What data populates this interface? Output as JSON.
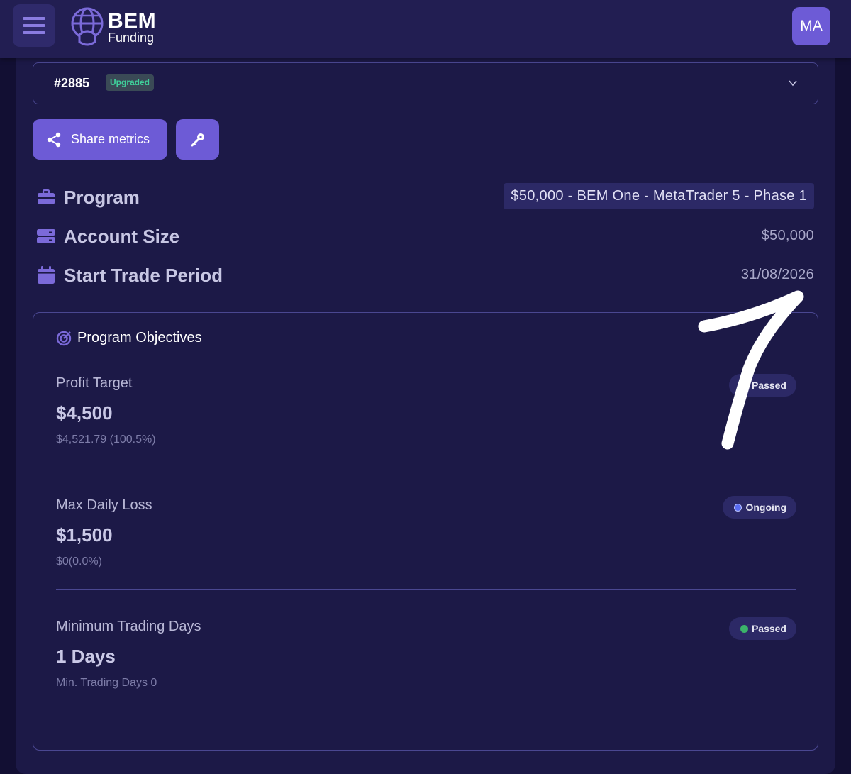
{
  "header": {
    "logo_main": "BEM",
    "logo_sub": "Funding",
    "avatar_initials": "MA",
    "menu_icon": "hamburger-icon"
  },
  "account": {
    "id": "#2885",
    "badge": "Upgraded",
    "chevron_icon": "chevron-down-icon"
  },
  "actions": {
    "share_label": "Share metrics",
    "share_icon": "share-icon",
    "key_icon": "key-icon"
  },
  "info": {
    "program_label": "Program",
    "program_value": "$50,000 - BEM One - MetaTrader 5 - Phase 1",
    "account_size_label": "Account Size",
    "account_size_value": "$50,000",
    "start_label": "Start Trade Period",
    "start_value": "31/08/2026"
  },
  "objectives": {
    "title": "Program Objectives",
    "items": [
      {
        "name": "Profit Target",
        "amount": "$4,500",
        "detail": "$4,521.79 (100.5%)",
        "status": "Passed"
      },
      {
        "name": "Max Daily Loss",
        "amount": "$1,500",
        "detail": "$0(0.0%)",
        "status": "Ongoing"
      },
      {
        "name": "Minimum Trading Days",
        "amount": "1 Days",
        "detail": "Min. Trading Days 0",
        "status": "Passed"
      }
    ]
  },
  "colors": {
    "background": "#120f33",
    "panel": "#1c1947",
    "accent": "#6d5bd6",
    "passed": "#3bb36a",
    "ongoing": "#5a6cf0",
    "badge_text": "#3fd09a"
  }
}
